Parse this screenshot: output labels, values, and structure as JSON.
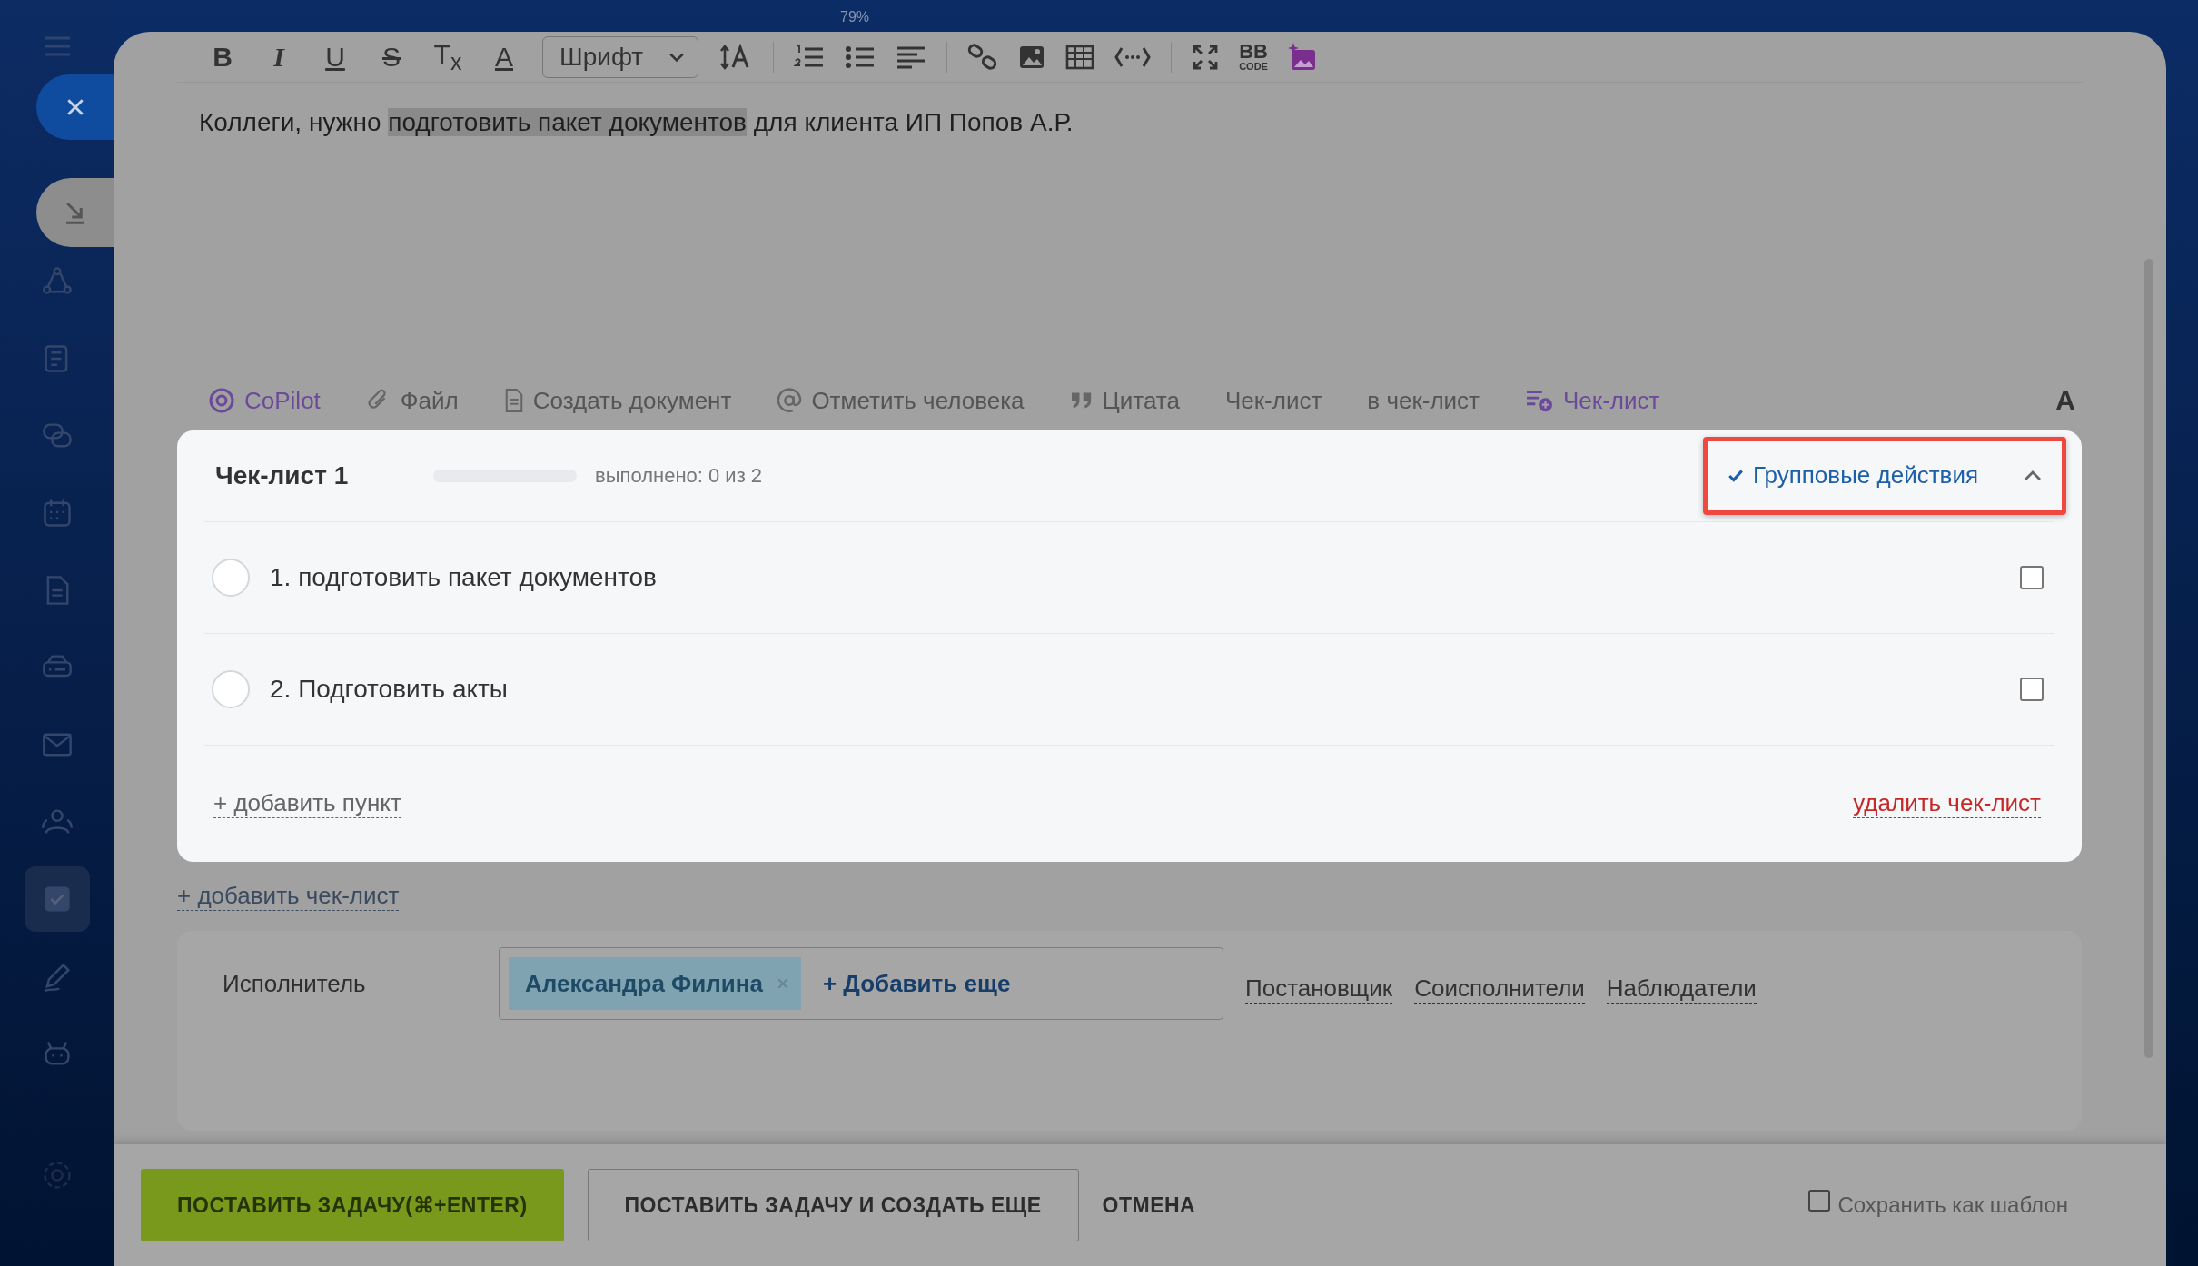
{
  "toolbar": {
    "zoom": "79%",
    "format_buttons": [
      {
        "kind": "bold",
        "label": "B"
      },
      {
        "kind": "italic",
        "label": "I"
      },
      {
        "kind": "underline",
        "label": "U"
      },
      {
        "kind": "strike",
        "label": "S"
      },
      {
        "kind": "clear",
        "label": "T$_{x}$"
      },
      {
        "kind": "color",
        "label": "A"
      }
    ],
    "font_select": "Шрифт",
    "bbcode": {
      "top": "BB",
      "bottom": "CODE"
    }
  },
  "editor": {
    "before": "Коллеги, нужно ",
    "highlighted": "подготовить пакет документов",
    "after": " для клиента ИП Попов А.Р."
  },
  "attachments": [
    {
      "kind": "copilot",
      "label": "CoPilot"
    },
    {
      "kind": "file",
      "label": "Файл"
    },
    {
      "kind": "document",
      "label": "Создать документ"
    },
    {
      "kind": "mention",
      "label": "Отметить человека"
    },
    {
      "kind": "quote",
      "label": "Цитата"
    },
    {
      "kind": "plain",
      "label": "Чек-лист"
    },
    {
      "kind": "plain",
      "label": "в чек-лист"
    },
    {
      "kind": "checklist",
      "label": "Чек-лист"
    }
  ],
  "text_toggle": "A",
  "checklist": {
    "title": "Чек-лист 1",
    "level": 0,
    "progress": "выполнено: 0 из 2",
    "group_actions": "Групповые действия",
    "highlighted": true,
    "expanded": true,
    "items": [
      {
        "label": "1. подготовить пакет документов",
        "done": false,
        "selected": false
      },
      {
        "label": "2. Подготовить акты",
        "done": false,
        "selected": false
      }
    ],
    "add_item": "+ добавить пункт",
    "delete": "удалить чек-лист"
  },
  "add_checklist": "+ добавить чек-лист",
  "assignee": {
    "label": "Исполнитель",
    "chips": [
      "Александра Филина"
    ],
    "add": "+ Добавить еще",
    "roles": [
      "Постановщик",
      "Соисполнители",
      "Наблюдатели"
    ]
  },
  "footer": {
    "buttons": [
      {
        "kind": "primary",
        "label": "ПОСТАВИТЬ ЗАДАЧУ(⌘+ENTER)"
      },
      {
        "kind": "secondary",
        "label": "ПОСТАВИТЬ ЗАДАЧУ И СОЗДАТЬ ЕЩЕ"
      },
      {
        "kind": "link",
        "label": "ОТМЕНА"
      }
    ],
    "save_template": {
      "label": "Сохранить как шаблон",
      "checked": false
    }
  }
}
